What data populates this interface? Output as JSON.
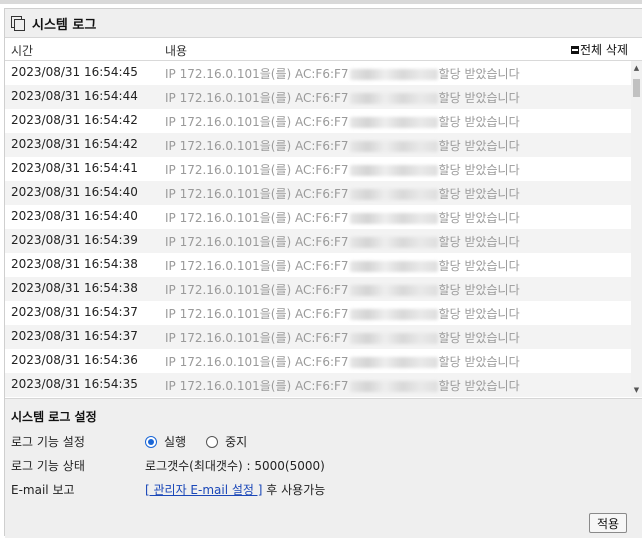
{
  "panel": {
    "title": "시스템 로그",
    "title_icon": "copy-windows-icon"
  },
  "columns": {
    "time": "시간",
    "message": "내용",
    "delete_all": "전체 삭제"
  },
  "log_rows": [
    {
      "time": "2023/08/31 16:54:45",
      "msg_prefix": "IP 172.16.0.101을(를) AC:F6:F7",
      "msg_suffix": "할당 받았습니다"
    },
    {
      "time": "2023/08/31 16:54:44",
      "msg_prefix": "IP 172.16.0.101을(를) AC:F6:F7",
      "msg_suffix": "할당 받았습니다"
    },
    {
      "time": "2023/08/31 16:54:42",
      "msg_prefix": "IP 172.16.0.101을(를) AC:F6:F7",
      "msg_suffix": "할당 받았습니다"
    },
    {
      "time": "2023/08/31 16:54:42",
      "msg_prefix": "IP 172.16.0.101을(를) AC:F6:F7",
      "msg_suffix": "할당 받았습니다"
    },
    {
      "time": "2023/08/31 16:54:41",
      "msg_prefix": "IP 172.16.0.101을(를) AC:F6:F7",
      "msg_suffix": "할당 받았습니다"
    },
    {
      "time": "2023/08/31 16:54:40",
      "msg_prefix": "IP 172.16.0.101을(를) AC:F6:F7",
      "msg_suffix": "할당 받았습니다"
    },
    {
      "time": "2023/08/31 16:54:40",
      "msg_prefix": "IP 172.16.0.101을(를) AC:F6:F7",
      "msg_suffix": "할당 받았습니다"
    },
    {
      "time": "2023/08/31 16:54:39",
      "msg_prefix": "IP 172.16.0.101을(를) AC:F6:F7",
      "msg_suffix": "할당 받았습니다"
    },
    {
      "time": "2023/08/31 16:54:38",
      "msg_prefix": "IP 172.16.0.101을(를) AC:F6:F7",
      "msg_suffix": "할당 받았습니다"
    },
    {
      "time": "2023/08/31 16:54:38",
      "msg_prefix": "IP 172.16.0.101을(를) AC:F6:F7",
      "msg_suffix": "할당 받았습니다"
    },
    {
      "time": "2023/08/31 16:54:37",
      "msg_prefix": "IP 172.16.0.101을(를) AC:F6:F7",
      "msg_suffix": "할당 받았습니다"
    },
    {
      "time": "2023/08/31 16:54:37",
      "msg_prefix": "IP 172.16.0.101을(를) AC:F6:F7",
      "msg_suffix": "할당 받았습니다"
    },
    {
      "time": "2023/08/31 16:54:36",
      "msg_prefix": "IP 172.16.0.101을(를) AC:F6:F7",
      "msg_suffix": "할당 받았습니다"
    },
    {
      "time": "2023/08/31 16:54:35",
      "msg_prefix": "IP 172.16.0.101을(를) AC:F6:F7",
      "msg_suffix": "할당 받았습니다"
    }
  ],
  "settings": {
    "title": "시스템 로그 설정",
    "log_function_label": "로그 기능 설정",
    "run_label": "실행",
    "stop_label": "중지",
    "selected": "run",
    "log_status_label": "로그 기능 상태",
    "log_status_value": "로그갯수(최대갯수) : 5000(5000)",
    "email_label": "E-mail 보고",
    "email_link": "[ 관리자 E-mail 설정 ]",
    "email_suffix": " 후 사용가능",
    "apply_label": "적용"
  },
  "colors": {
    "accent": "#1a66d6",
    "link": "#1a47b8",
    "log_text": "#9a9a9a"
  }
}
